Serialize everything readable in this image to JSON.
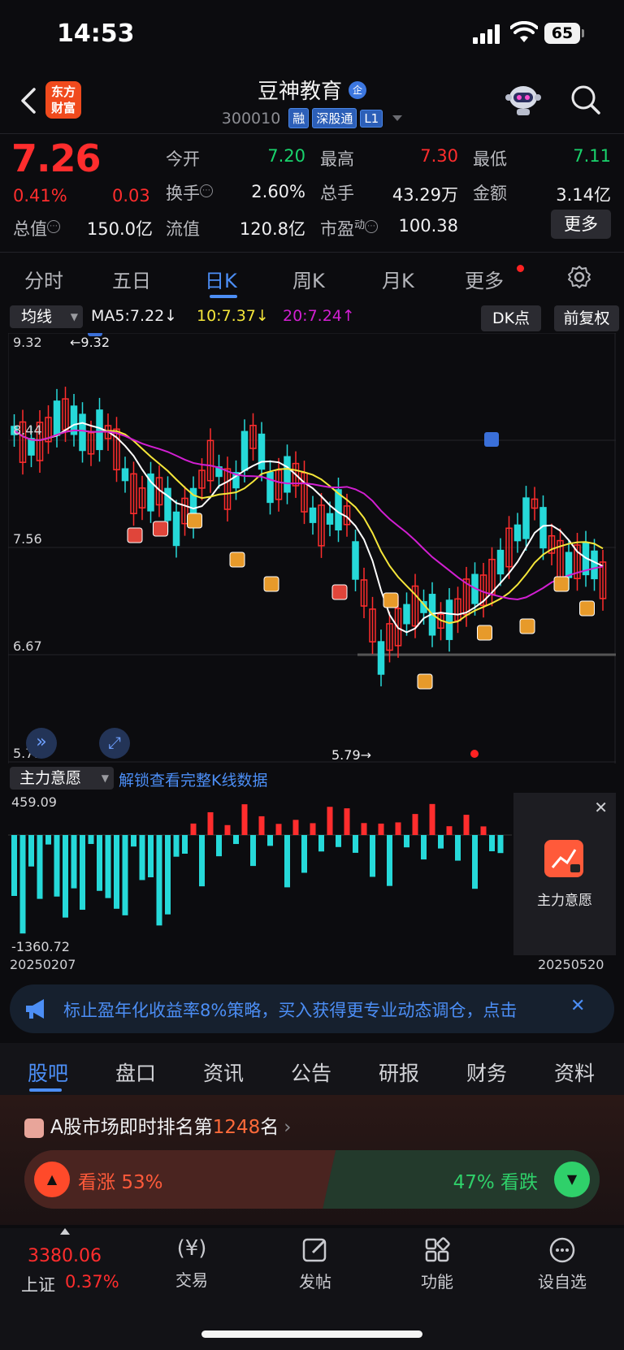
{
  "status": {
    "time": "14:53",
    "battery": "65"
  },
  "header": {
    "logo_line1": "东方",
    "logo_line2": "财富",
    "stock_name": "豆神教育",
    "badge": "企",
    "code": "300010",
    "tags": [
      "融",
      "深股通",
      "L1"
    ]
  },
  "quote": {
    "price": "7.26",
    "change_pct": "0.41%",
    "change": "0.03",
    "open_label": "今开",
    "open": "7.20",
    "high_label": "最高",
    "high": "7.30",
    "low_label": "最低",
    "low": "7.11",
    "turnover_label": "换手",
    "turnover": "2.60%",
    "volume_label": "总手",
    "volume": "43.29万",
    "amount_label": "金额",
    "amount": "3.14亿",
    "mcap_label": "总值",
    "mcap": "150.0亿",
    "float_label": "流值",
    "float": "120.8亿",
    "pe_label": "市盈",
    "pe_sup": "动",
    "pe": "100.38",
    "more": "更多"
  },
  "chart_tabs": [
    "分时",
    "五日",
    "日K",
    "周K",
    "月K",
    "更多"
  ],
  "ma": {
    "selector": "均线",
    "ma5": "MA5:7.22↓",
    "ma10": "10:7.37↓",
    "ma20": "20:7.24↑",
    "dk": "DK点",
    "fq": "前复权"
  },
  "kchart": {
    "y_top": "9.32",
    "y2": "8.44",
    "y3": "7.56",
    "y4": "6.67",
    "y_bottom": "5.79",
    "max_label": "←9.32",
    "min_label": "5.79→"
  },
  "indicator": {
    "selector": "主力意愿",
    "unlock": "解锁查看完整K线数据",
    "top": "459.09",
    "bottom": "-1360.72",
    "start_date": "20250207",
    "end_date": "20250520",
    "panel_label": "主力意愿"
  },
  "banner": {
    "text": "标止盈年化收益率8%策略，买入获得更专业动态调仓，点击"
  },
  "section_tabs": [
    "股吧",
    "盘口",
    "资讯",
    "公告",
    "研报",
    "财务",
    "资料"
  ],
  "rank": {
    "prefix": "A股市场即时排名第",
    "number": "1248",
    "suffix": "名"
  },
  "vote": {
    "up_label": "看涨",
    "up_pct": "53%",
    "down_pct": "47%",
    "down_label": "看跌",
    "up_fraction": 0.53
  },
  "bottom": {
    "index_value": "3380.06",
    "index_name": "上证",
    "index_change": "0.37%",
    "items": [
      "交易",
      "发帖",
      "功能",
      "设自选"
    ]
  },
  "colors": {
    "up": "#ff2d2d",
    "down": "#19d36c",
    "accent": "#4c8ef5",
    "cyan": "#26d9d9",
    "ma10": "#f5e63a",
    "ma20": "#d21fd2"
  }
}
